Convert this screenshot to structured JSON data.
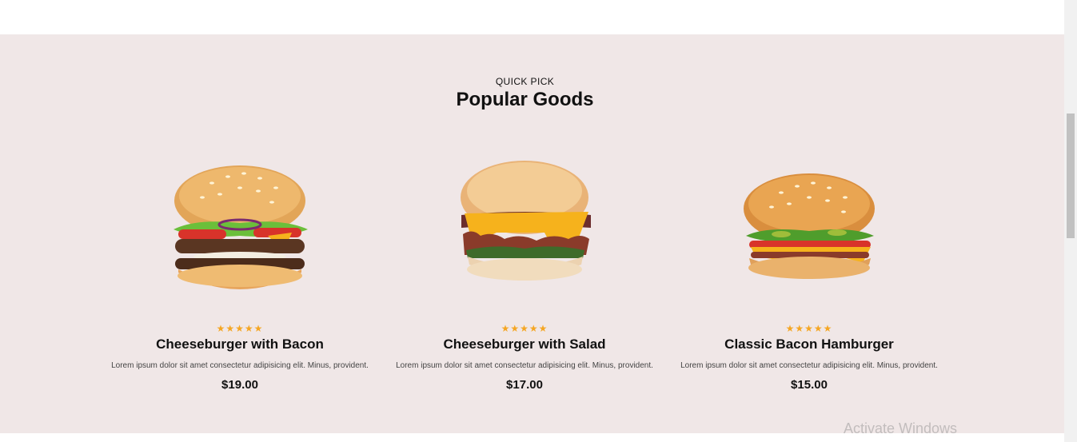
{
  "section": {
    "eyebrow": "QUICK PICK",
    "title": "Popular Goods"
  },
  "products": [
    {
      "name": "Cheeseburger with Bacon",
      "description": "Lorem ipsum dolor sit amet consectetur adipisicing elit. Minus, provident.",
      "price": "$19.00",
      "rating": 5,
      "stars": "★★★★★",
      "image_icon": "burger-image"
    },
    {
      "name": "Cheeseburger with Salad",
      "description": "Lorem ipsum dolor sit amet consectetur adipisicing elit. Minus, provident.",
      "price": "$17.00",
      "rating": 5,
      "stars": "★★★★★",
      "image_icon": "burger-image"
    },
    {
      "name": "Classic Bacon Hamburger",
      "description": "Lorem ipsum dolor sit amet consectetur adipisicing elit. Minus, provident.",
      "price": "$15.00",
      "rating": 5,
      "stars": "★★★★★",
      "image_icon": "burger-image"
    }
  ],
  "watermark": "Activate Windows",
  "colors": {
    "section_bg": "#f0e7e7",
    "star": "#f5a623",
    "text": "#111111"
  }
}
